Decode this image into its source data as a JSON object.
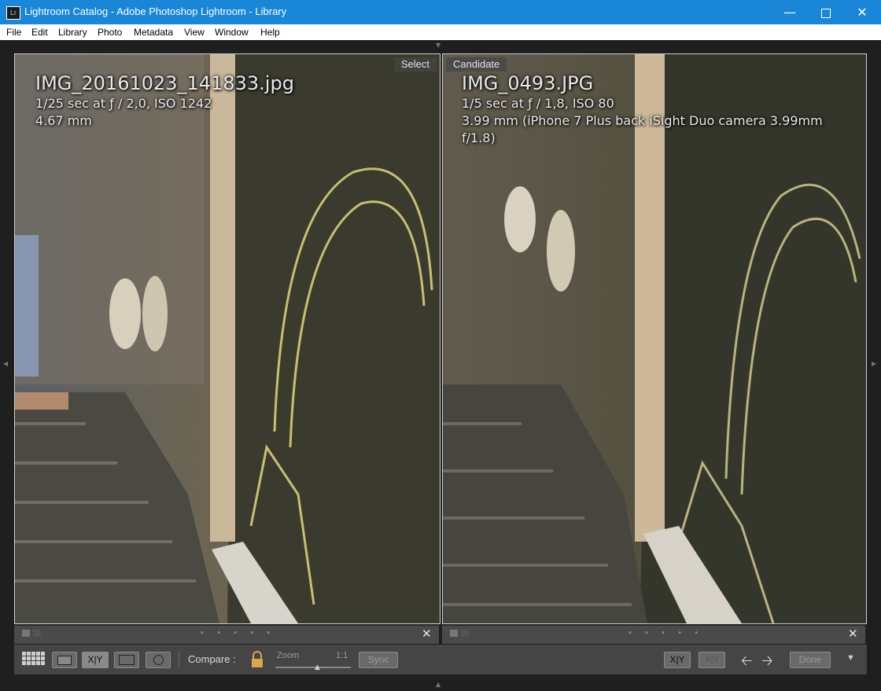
{
  "window": {
    "app_icon": "Lr",
    "title": "Lightroom Catalog - Adobe Photoshop Lightroom - Library",
    "minimize_icon": "minimize-icon",
    "maximize_icon": "maximize-icon",
    "close_icon": "close-icon"
  },
  "menu": [
    "File",
    "Edit",
    "Library",
    "Photo",
    "Metadata",
    "View",
    "Window",
    "Help"
  ],
  "panes": {
    "left": {
      "tag": "Select",
      "filename": "IMG_20161023_141833.jpg",
      "line1": "1/25 sec at ƒ / 2,0, ISO 1242",
      "line2": "4.67 mm",
      "line3": ""
    },
    "right": {
      "tag": "Candidate",
      "filename": "IMG_0493.JPG",
      "line1": "1/5 sec at ƒ / 1,8, ISO 80",
      "line2": "3.99 mm (iPhone 7 Plus back iSight Duo camera 3.99mm",
      "line3": "f/1.8)"
    }
  },
  "subbar": {
    "dots": "• • • • •",
    "close": "✕"
  },
  "toolbar": {
    "grid_icon": "grid-view-icon",
    "loupe_icon": "loupe-view-icon",
    "compare_label": "X|Y",
    "survey_icon": "survey-view-icon",
    "people_icon": "people-view-icon",
    "compare_text": "Compare :",
    "lock_icon": "lock-icon",
    "zoom_label": "Zoom",
    "zoom_ratio": "1:1",
    "sync": "Sync",
    "swap_label": "X|Y",
    "make_select_label": "X|Y",
    "prev_icon": "arrow-left-icon",
    "next_icon": "arrow-right-icon",
    "done": "Done",
    "menu_icon": "chevron-down-icon"
  },
  "colors": {
    "titlebar": "#1a86d8",
    "workspace": "#1f1f1f",
    "toolbar": "#454545"
  }
}
